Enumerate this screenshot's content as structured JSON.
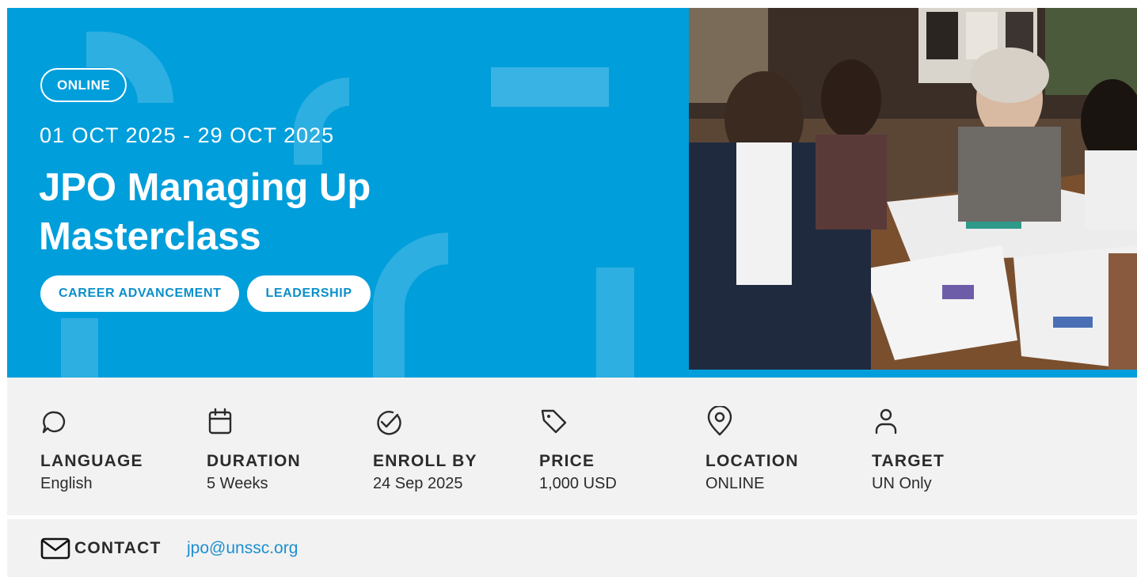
{
  "hero": {
    "mode_badge": "ONLINE",
    "dates": "01 OCT 2025 - 29 OCT 2025",
    "title": "JPO Managing Up Masterclass",
    "tags": [
      "CAREER ADVANCEMENT",
      "LEADERSHIP"
    ],
    "accent_color": "#009edb",
    "photo_icon": "meeting-photo"
  },
  "details": [
    {
      "icon": "chat-bubble-icon",
      "label": "LANGUAGE",
      "value": "English"
    },
    {
      "icon": "calendar-icon",
      "label": "DURATION",
      "value": "5 Weeks"
    },
    {
      "icon": "check-circle-icon",
      "label": "ENROLL BY",
      "value": "24 Sep 2025"
    },
    {
      "icon": "price-tag-icon",
      "label": "PRICE",
      "value": "1,000 USD"
    },
    {
      "icon": "location-pin-icon",
      "label": "LOCATION",
      "value": "ONLINE"
    },
    {
      "icon": "user-icon",
      "label": "TARGET",
      "value": "UN Only"
    }
  ],
  "contact": {
    "icon": "mail-icon",
    "label": "CONTACT",
    "email": "jpo@unssc.org",
    "link_color": "#1d8fcf"
  }
}
